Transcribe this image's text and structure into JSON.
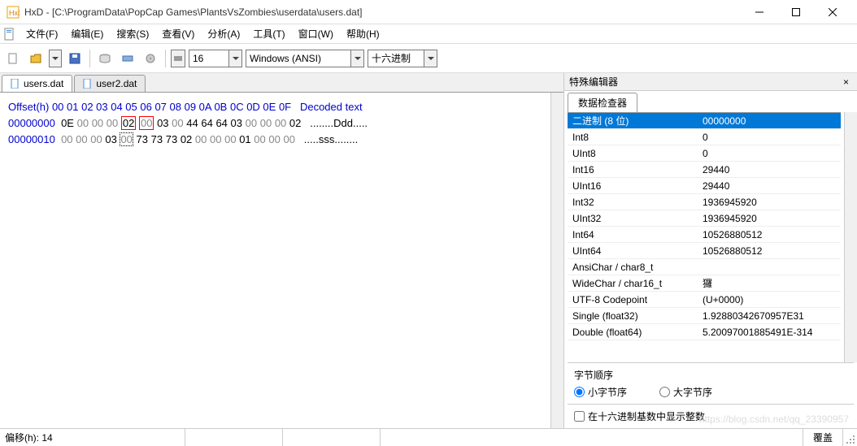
{
  "window": {
    "title": "HxD - [C:\\ProgramData\\PopCap Games\\PlantsVsZombies\\userdata\\users.dat]"
  },
  "menu": {
    "file": "文件(F)",
    "edit": "编辑(E)",
    "search": "搜索(S)",
    "view": "查看(V)",
    "analyze": "分析(A)",
    "tool": "工具(T)",
    "window": "窗口(W)",
    "help": "帮助(H)"
  },
  "toolbar": {
    "bytes_per_row": "16",
    "encoding": "Windows (ANSI)",
    "base": "十六进制"
  },
  "tabs": {
    "t0": "users.dat",
    "t1": "user2.dat"
  },
  "hex": {
    "header_offset": "Offset(h)",
    "header_cols": "00 01 02 03 04 05 06 07 08 09 0A 0B 0C 0D 0E 0F",
    "header_dec": "Decoded text",
    "rows": [
      {
        "offset": "00000000",
        "bytes": [
          "0E",
          "00",
          "00",
          "00",
          "02",
          "00",
          "03",
          "00",
          "44",
          "64",
          "64",
          "03",
          "00",
          "00",
          "00",
          "02"
        ],
        "decoded": "........Ddd....."
      },
      {
        "offset": "00000010",
        "bytes": [
          "00",
          "00",
          "00",
          "03",
          "00",
          "73",
          "73",
          "73",
          "02",
          "00",
          "00",
          "00",
          "01",
          "00",
          "00",
          "00"
        ],
        "decoded": ".....sss........"
      }
    ]
  },
  "panel": {
    "title": "特殊编辑器",
    "tab": "数据检查器",
    "rows": [
      {
        "k": "二进制 (8 位)",
        "v": "00000000"
      },
      {
        "k": "Int8",
        "v": "0"
      },
      {
        "k": "UInt8",
        "v": "0"
      },
      {
        "k": "Int16",
        "v": "29440"
      },
      {
        "k": "UInt16",
        "v": "29440"
      },
      {
        "k": "Int32",
        "v": "1936945920"
      },
      {
        "k": "UInt32",
        "v": "1936945920"
      },
      {
        "k": "Int64",
        "v": "10526880512"
      },
      {
        "k": "UInt64",
        "v": "10526880512"
      },
      {
        "k": "AnsiChar / char8_t",
        "v": ""
      },
      {
        "k": "WideChar / char16_t",
        "v": "玀"
      },
      {
        "k": "UTF-8 Codepoint",
        "v": "   (U+0000)"
      },
      {
        "k": "Single (float32)",
        "v": "1.92880342670957E31"
      },
      {
        "k": "Double (float64)",
        "v": "5.20097001885491E-314"
      }
    ],
    "byteorder_title": "字节顺序",
    "little": "小字节序",
    "big": "大字节序",
    "hex_check": "在十六进制基数中显示整数"
  },
  "status": {
    "offset": "偏移(h): 14",
    "overwrite": "覆盖"
  }
}
